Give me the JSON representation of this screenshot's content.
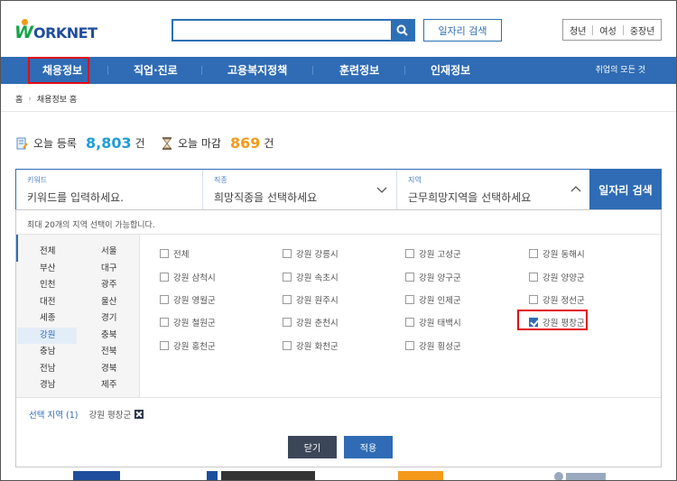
{
  "header": {
    "logo_letter": "W",
    "logo_rest": "ORKNET",
    "search": {
      "value": "",
      "placeholder": ""
    },
    "job_search_button": "일자리 검색",
    "user_tabs": [
      "청년",
      "여성",
      "중장년"
    ]
  },
  "nav": {
    "items": [
      "채용정보",
      "직업·진로",
      "고용복지정책",
      "훈련정보",
      "인재정보"
    ],
    "all_link": "취업의 모든 것"
  },
  "breadcrumb": [
    "홈",
    "채용정보 홈"
  ],
  "stats": {
    "today_reg_label": "오늘 등록",
    "today_reg_value": "8,803",
    "today_reg_unit": "건",
    "today_close_label": "오늘 마감",
    "today_close_value": "869",
    "today_close_unit": "건",
    "colors": {
      "reg": "#1f9ed6",
      "close": "#f39a1b"
    }
  },
  "search_form": {
    "keyword": {
      "label": "키워드",
      "placeholder": "키워드를 입력하세요."
    },
    "job": {
      "label": "직종",
      "value": "희망직종을 선택하세요"
    },
    "region": {
      "label": "지역",
      "value": "근무희망지역을 선택하세요"
    },
    "submit_label": "일자리 검색"
  },
  "region_panel": {
    "note": "최대 20개의 지역 선택이 가능합니다.",
    "regions_left": [
      "전체",
      "부산",
      "인천",
      "대전",
      "세종",
      "강원",
      "충남",
      "전남",
      "경남"
    ],
    "regions_right": [
      "서울",
      "대구",
      "광주",
      "울산",
      "경기",
      "충북",
      "전북",
      "경북",
      "제주"
    ],
    "selected_region": "강원",
    "subregions": [
      {
        "label": "전체",
        "checked": false
      },
      {
        "label": "강원 강릉시",
        "checked": false
      },
      {
        "label": "강원 고성군",
        "checked": false
      },
      {
        "label": "강원 동해시",
        "checked": false
      },
      {
        "label": "강원 삼척시",
        "checked": false
      },
      {
        "label": "강원 속초시",
        "checked": false
      },
      {
        "label": "강원 양구군",
        "checked": false
      },
      {
        "label": "강원 양양군",
        "checked": false
      },
      {
        "label": "강원 영월군",
        "checked": false
      },
      {
        "label": "강원 원주시",
        "checked": false
      },
      {
        "label": "강원 인제군",
        "checked": false
      },
      {
        "label": "강원 정선군",
        "checked": false
      },
      {
        "label": "강원 철원군",
        "checked": false
      },
      {
        "label": "강원 춘천시",
        "checked": false
      },
      {
        "label": "강원 태백시",
        "checked": false
      },
      {
        "label": "강원 평창군",
        "checked": true
      },
      {
        "label": "강원 홍천군",
        "checked": false
      },
      {
        "label": "강원 화천군",
        "checked": false
      },
      {
        "label": "강원 횡성군",
        "checked": false
      }
    ],
    "selected_label": "선택 지역 (1)",
    "selected_value": "강원 평창군",
    "close_button": "닫기",
    "apply_button": "적용"
  },
  "accent_colors": {
    "primary": "#2f6cb5",
    "highlight": "#e30b16"
  }
}
